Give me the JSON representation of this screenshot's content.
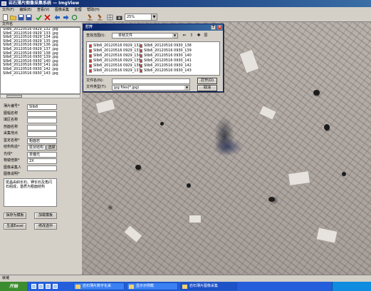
{
  "window": {
    "title": "岩石薄片图像采集系统 — ImgView"
  },
  "menu": [
    "文件(F)",
    "编辑(E)",
    "查看(V)",
    "图像采集",
    "处理",
    "帮助(H)"
  ],
  "toolbar": {
    "zoom": "25%"
  },
  "file_list": {
    "header": "文件名",
    "items": [
      "SIIb6_20120516 0929_132 .jpg",
      "SIIb6_20120516 0929_133 .jpg",
      "SIIb6_20120516 0929_134 .jpg",
      "SIIb6_20120516 0929_135 .jpg",
      "SIIb6_20120516 0929_136 .jpg",
      "SIIb6_20120516 0929_137 .jpg",
      "SIIb6_20120516 0930_138 .jpg",
      "SIIb6_20120516 0930_139 .jpg",
      "SIIb6_20120516 0930_140 .jpg",
      "SIIb6_20120516 0930_141 .jpg",
      "SIIb6_20120516 0930_142 .jpg",
      "SIIb6_20120516 0930_143 .jpg"
    ]
  },
  "form": {
    "fields": [
      {
        "label": "薄片编号*",
        "value": "SIIb6"
      },
      {
        "label": "图幅名称",
        "value": ""
      },
      {
        "label": "填区名称",
        "value": ""
      },
      {
        "label": "剖面名称",
        "value": ""
      },
      {
        "label": "采集地点",
        "value": ""
      },
      {
        "label": "鉴定名称*",
        "value": "粗面岩"
      },
      {
        "label": "结构构造*",
        "value": "斑状结构"
      },
      {
        "label": "光线*",
        "value": "单偏光"
      },
      {
        "label": "物镜倍数*",
        "value": "2X"
      },
      {
        "label": "图像采集人",
        "value": ""
      }
    ],
    "structure_button": "选择",
    "desc_label": "图像说明*",
    "desc_text": "斑晶由斜长石、钾长石及角闪石组成，基质为粗面结构",
    "save_template": "保存为模板",
    "load_template": "加载模板",
    "export_excel": "生成Excel",
    "modify_selected": "修改选中"
  },
  "dialog": {
    "title": "打开",
    "look_in_label": "查找范围(I):",
    "look_in_value": "单帧文件",
    "files_col1": [
      "SIIb6_20120516 0929_132",
      "SIIb6_20120516 0929_133",
      "SIIb6_20120516 0929_134",
      "SIIb6_20120516 0929_135",
      "SIIb6_20120516 0929_136",
      "SIIb6_20120516 0929_137"
    ],
    "files_col2": [
      "SIIb6_20120516 0930_138",
      "SIIb6_20120516 0930_139",
      "SIIb6_20120516 0930_140",
      "SIIb6_20120516 0930_141",
      "SIIb6_20120516 0930_142",
      "SIIb6_20120516 0930_143"
    ],
    "filename_label": "文件名(N):",
    "filename_value": "",
    "filetype_label": "文件类型(T):",
    "filetype_value": "jpg files(*.jpg)",
    "open_button": "打开(O)",
    "cancel_button": "取消"
  },
  "status": "就绪",
  "taskbar": {
    "start": "开始",
    "tasks": [
      "岩石薄片数字化采",
      "显示示例截",
      "岩石薄片图像采集"
    ]
  }
}
